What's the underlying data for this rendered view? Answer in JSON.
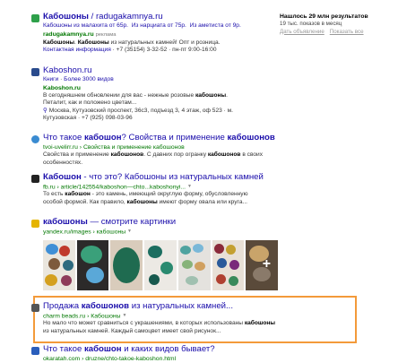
{
  "stats": {
    "found": "Нашлось 29 млн результатов",
    "shows": "19 тыс. показов в месяц",
    "options": [
      "Дать объявление",
      "Показать все"
    ]
  },
  "results": [
    {
      "favicon_color": "#2ea04a",
      "title_bold": "Кабошоны",
      "title_rest": " / radugakamnya.ru",
      "sitelinks": [
        "Кабошоны из малахита от 65р.",
        "Из нарциата от 75р.",
        "Из аметиста от 9р."
      ],
      "url": "radugakamnya.ru",
      "ad_label": "реклама",
      "snippet": "Кабошоны. Кабошоны из натуральных камней! Опт и розница.",
      "contact": "Контактная информация",
      "phone": "+7 (35154) 3-32-52 · пн-пт 9:00-16:00"
    },
    {
      "favicon_color": "#2a4b8d",
      "title": "Kaboshon.ru",
      "meta_left": "Книги",
      "meta_right": "Более 3000 видов",
      "url": "Kaboshon.ru",
      "snippet": "В сегодняшнем обновлении для вас - нежные розовые кабошоны. Петалит, как и положено цветам...",
      "address": "Москва, Кутузовский проспект, 36с3, подъезд 3, 4 этаж, оф 523 · м. Кутузовская · +7 (925) 098-03-96"
    },
    {
      "favicon_color": "#3a8bd1",
      "title_a": "Что такое ",
      "title_bold": "кабошон",
      "title_b": "? Свойства и применение ",
      "title_bold2": "кабошонов",
      "url": "tvoi-uvelirr.ru › Свойства и применение кабошонов",
      "snippet": "Свойства и применение кабошонов. С давних пор огранку кабошонов в своих особенностях."
    },
    {
      "favicon_color": "#222222",
      "title_a": "Кабошон",
      "title_b": " - что это? Кабошоны из натуральных камней",
      "url": "fb.ru › article/142554/kaboshon—chto...kaboshonyi...",
      "snippet": "То есть кабошон - это камень, имеющий округлую форму, обусловленную особой формой. Как правило, кабошоны имеют форму овала или круга..."
    },
    {
      "favicon_color": "#e5b400",
      "title_bold": "кабошоны",
      "title_rest": " — смотрите картинки",
      "url": "yandex.ru/images › кабошоны"
    },
    {
      "favicon_color": "#555555",
      "title_a": "Продажа ",
      "title_bold": "кабошонов",
      "title_b": " из натуральных камней...",
      "url": "charm beads.ru › Кабошоны",
      "snippet": "Но мало что может сравниться с украшениями, в которых использованы кабошоны из натуральных камней. Каждый самоцвет имеет свой рисунок..."
    },
    {
      "favicon_color": "#2a5ebc",
      "title_a": "Что такое ",
      "title_bold": "кабошон",
      "title_b": " и каких видов бывает?",
      "url": "okaratah.com › druzne/chto-takoe-kaboshon.html"
    }
  ]
}
